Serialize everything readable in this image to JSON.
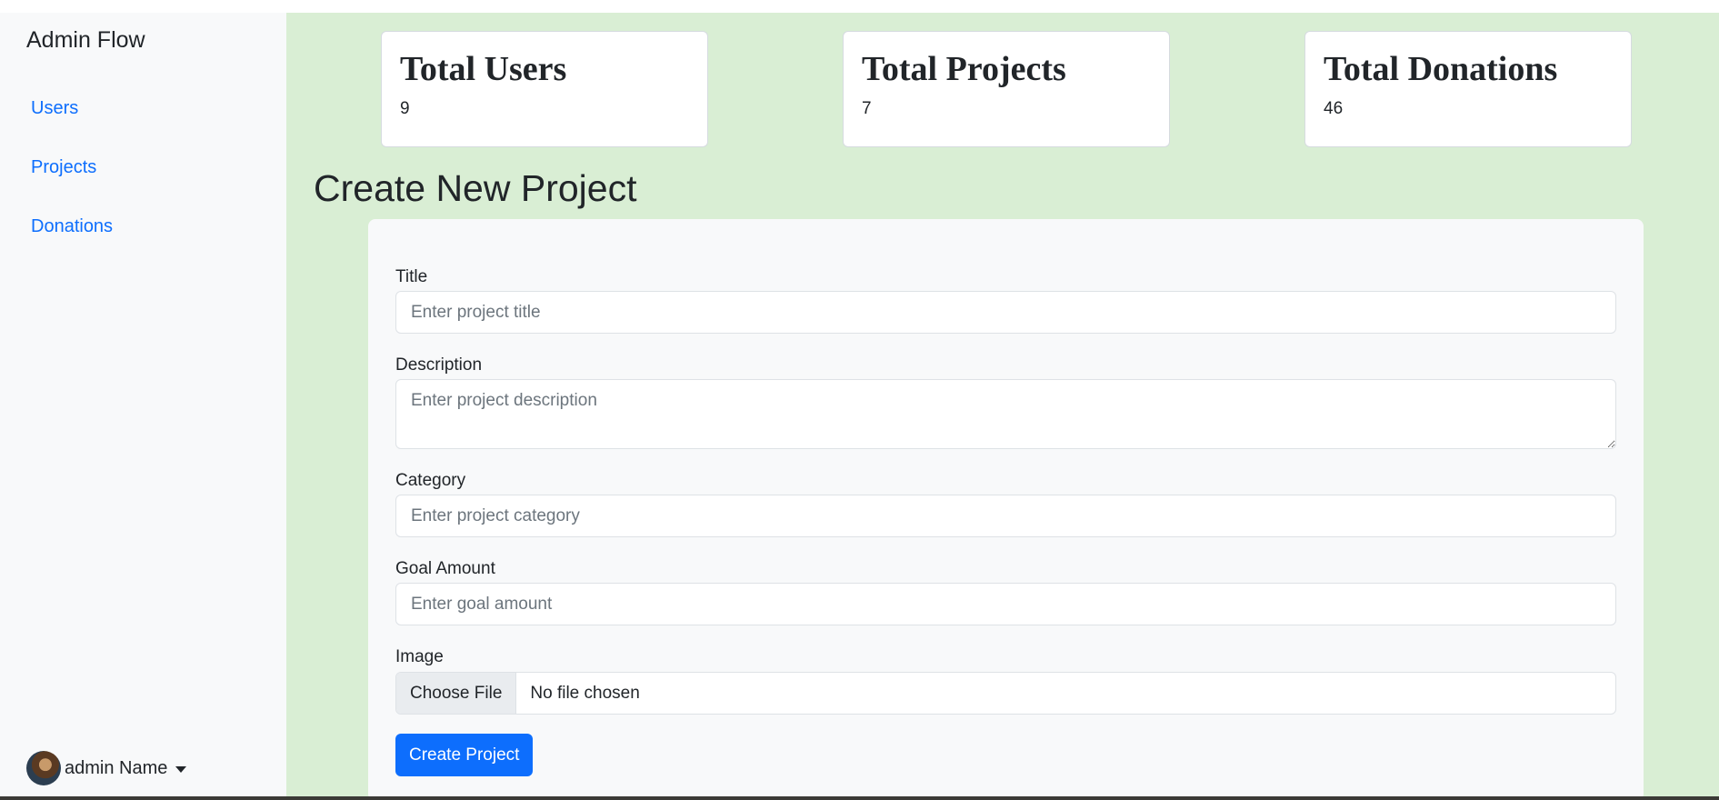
{
  "sidebar": {
    "brand": "Admin Flow",
    "nav": [
      {
        "label": "Users"
      },
      {
        "label": "Projects"
      },
      {
        "label": "Donations"
      }
    ],
    "user": {
      "name": "admin Name",
      "avatar_icon": "user-avatar"
    }
  },
  "stats": [
    {
      "title": "Total Users",
      "value": "9"
    },
    {
      "title": "Total Projects",
      "value": "7"
    },
    {
      "title": "Total Donations",
      "value": "46"
    }
  ],
  "form": {
    "heading": "Create New Project",
    "title": {
      "label": "Title",
      "placeholder": "Enter project title"
    },
    "description": {
      "label": "Description",
      "placeholder": "Enter project description"
    },
    "category": {
      "label": "Category",
      "placeholder": "Enter project category"
    },
    "goal": {
      "label": "Goal Amount",
      "placeholder": "Enter goal amount"
    },
    "image": {
      "label": "Image",
      "button": "Choose File",
      "status": "No file chosen"
    },
    "submit": "Create Project"
  },
  "colors": {
    "sidebar_bg": "#f8f9fa",
    "main_bg": "#d9eed4",
    "link": "#0d6efd",
    "primary_button": "#0d6efd"
  }
}
